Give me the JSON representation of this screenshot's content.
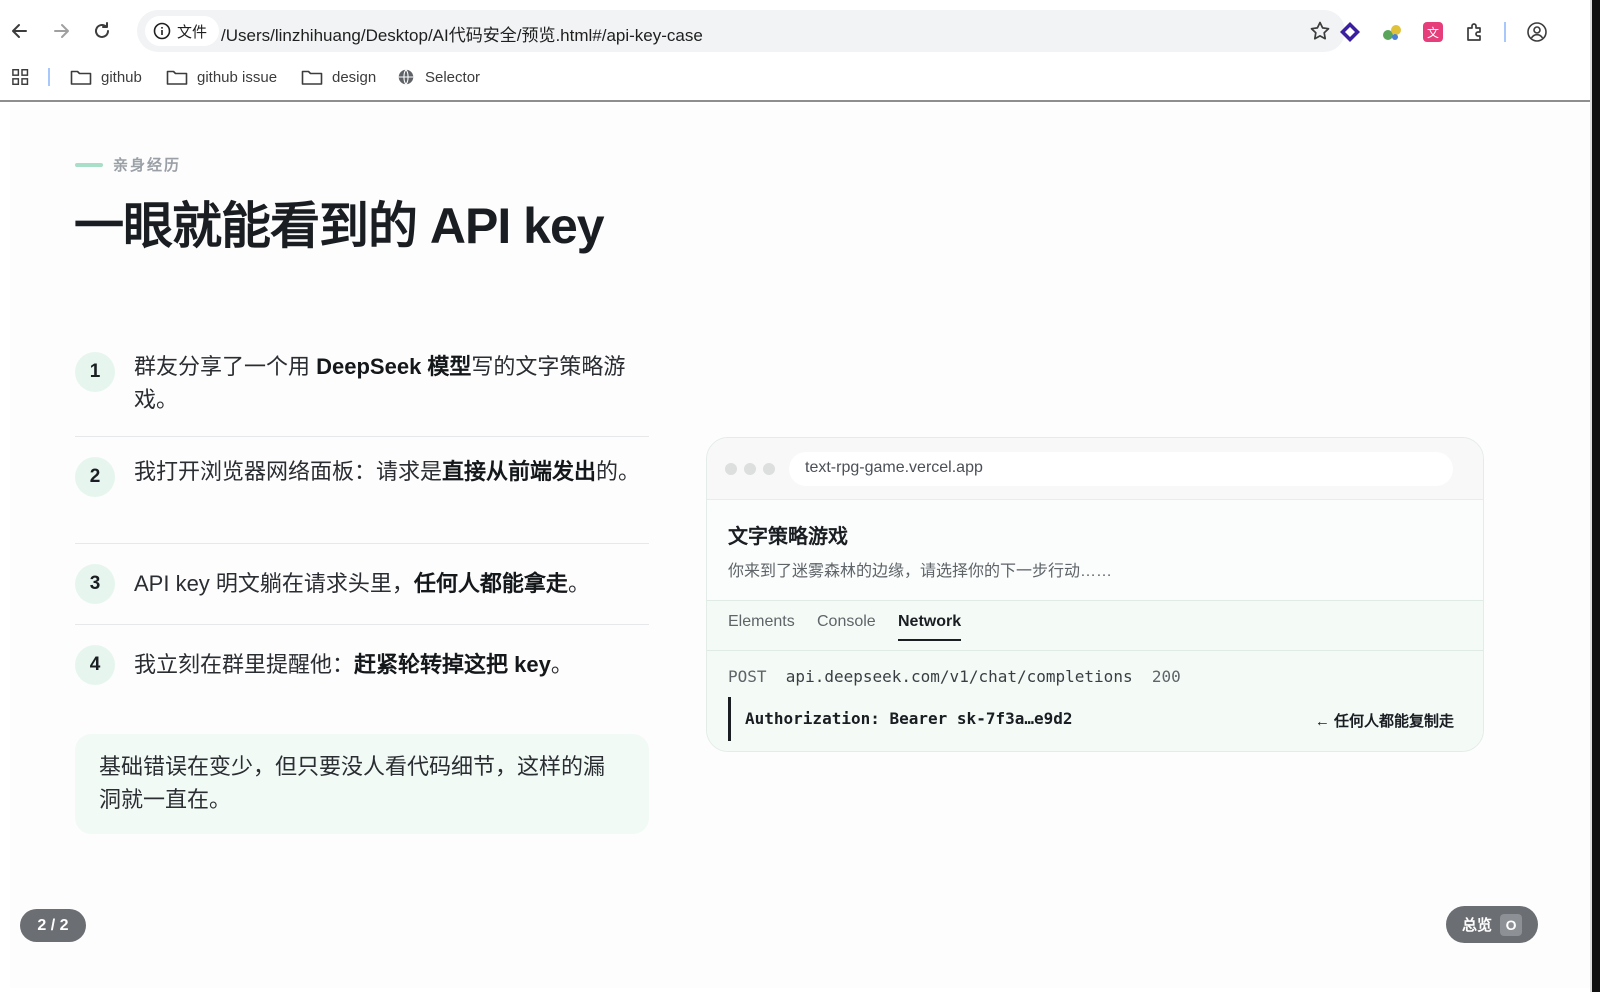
{
  "browser": {
    "site_info_label": "文件",
    "url": "/Users/linzhihuang/Desktop/AI代码安全/预览.html#/api-key-case",
    "bookmarks": [
      {
        "label": "github",
        "icon": "folder-icon"
      },
      {
        "label": "github issue",
        "icon": "folder-icon"
      },
      {
        "label": "design",
        "icon": "folder-icon"
      },
      {
        "label": "Selector",
        "icon": "globe-icon"
      }
    ]
  },
  "slide": {
    "eyebrow": "亲身经历",
    "title": "一眼就能看到的 API key",
    "steps": [
      {
        "num": "1",
        "pre": "群友分享了一个用 ",
        "bold": "DeepSeek 模型",
        "post": "写的文字策略游戏。"
      },
      {
        "num": "2",
        "pre": "我打开浏览器网络面板：请求是",
        "bold": "直接从前端发出",
        "post": "的。"
      },
      {
        "num": "3",
        "pre": "API key 明文躺在请求头里，",
        "bold": "任何人都能拿走",
        "post": "。"
      },
      {
        "num": "4",
        "pre": "我立刻在群里提醒他：",
        "bold": "赶紧轮转掉这把 key",
        "post": "。"
      }
    ],
    "note": "基础错误在变少，但只要没人看代码细节，这样的漏洞就一直在。"
  },
  "mock": {
    "url": "text-rpg-game.vercel.app",
    "app_title": "文字策略游戏",
    "app_subtitle": "你来到了迷雾森林的边缘，请选择你的下一步行动……",
    "tabs": [
      "Elements",
      "Console",
      "Network"
    ],
    "active_tab": "Network",
    "request_method": "POST",
    "request_url": "api.deepseek.com/v1/chat/completions",
    "request_status": "200",
    "auth_header": "Authorization: Bearer sk-7f3a…e9d2",
    "auth_hint": "← 任何人都能复制走"
  },
  "footer": {
    "counter": "2 / 2",
    "overview_label": "总览",
    "overview_key": "O"
  },
  "colors": {
    "accent": "#a9dec8",
    "badge_bg": "#e6f6ee",
    "note_bg": "#f2faf6",
    "pill_bg": "#6b6e72"
  }
}
